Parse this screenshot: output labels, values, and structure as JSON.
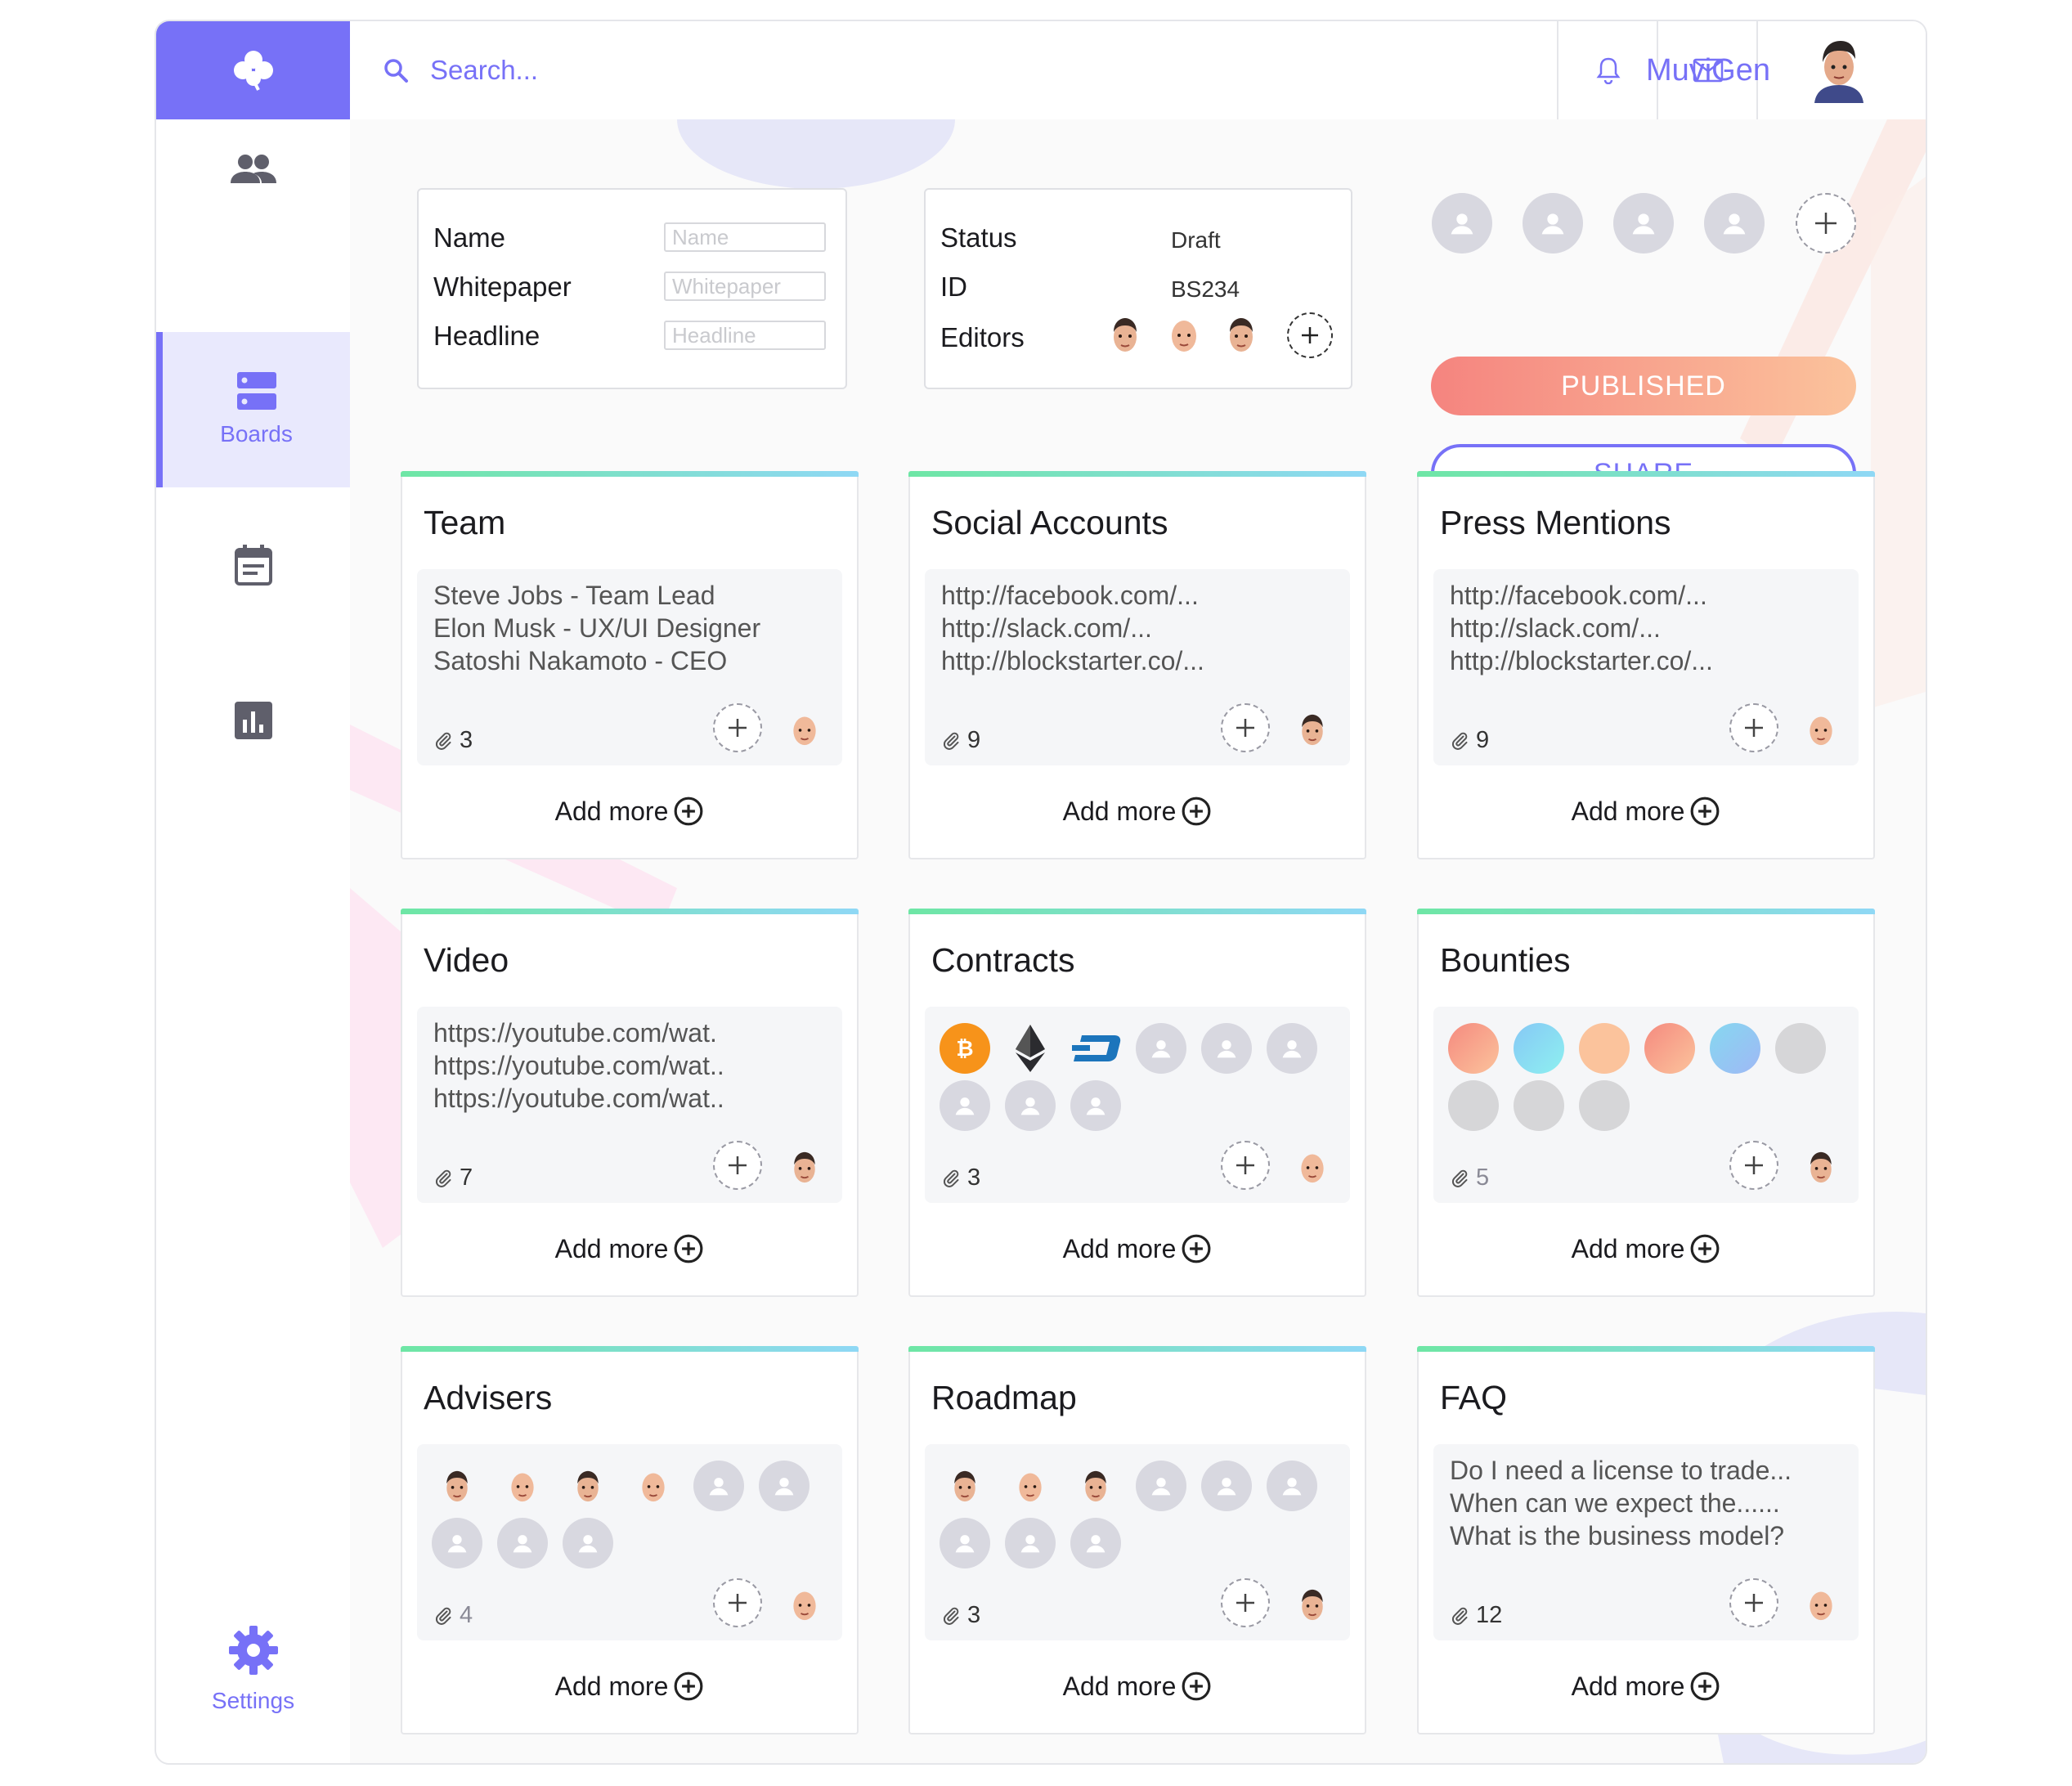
{
  "header": {
    "search_placeholder": "Search...",
    "user_name": "MuviGen"
  },
  "sidebar": {
    "items": [
      {
        "name": "people",
        "label": ""
      },
      {
        "name": "boards",
        "label": "Boards",
        "active": true
      },
      {
        "name": "calendar",
        "label": ""
      },
      {
        "name": "stats",
        "label": ""
      }
    ],
    "settings_label": "Settings"
  },
  "meta_form": {
    "name_label": "Name",
    "name_placeholder": "Name",
    "whitepaper_label": "Whitepaper",
    "whitepaper_placeholder": "Whitepaper",
    "headline_label": "Headline",
    "headline_placeholder": "Headline"
  },
  "status_box": {
    "status_label": "Status",
    "status_value": "Draft",
    "id_label": "ID",
    "id_value": "BS234",
    "editors_label": "Editors"
  },
  "actions": {
    "published_label": "PUBLISHED",
    "share_label": "SHARE"
  },
  "colors": {
    "accent": "#7771f7",
    "published_start": "#f5847f",
    "published_end": "#fbc39c",
    "card_top_start": "#6ee6a5",
    "card_top_end": "#8fd8f5"
  },
  "cards": [
    {
      "title": "Team",
      "lines": [
        "Steve Jobs - Team Lead",
        "Elon Musk - UX/UI Designer",
        "Satoshi Nakamoto - CEO"
      ],
      "attachments": "3",
      "add_more": "Add more"
    },
    {
      "title": "Social Accounts",
      "lines": [
        "http://facebook.com/...",
        "http://slack.com/...",
        "http://blockstarter.co/..."
      ],
      "attachments": "9",
      "add_more": "Add more"
    },
    {
      "title": "Press Mentions",
      "lines": [
        "http://facebook.com/...",
        "http://slack.com/...",
        "http://blockstarter.co/..."
      ],
      "attachments": "9",
      "add_more": "Add more"
    },
    {
      "title": "Video",
      "lines": [
        "https://youtube.com/wat.",
        "https://youtube.com/wat..",
        "https://youtube.com/wat.."
      ],
      "attachments": "7",
      "add_more": "Add more"
    },
    {
      "title": "Contracts",
      "icons": [
        "bitcoin-icon",
        "ethereum-icon",
        "dash-icon"
      ],
      "attachments": "3",
      "add_more": "Add more"
    },
    {
      "title": "Bounties",
      "swatches": [
        "#f58a7f",
        "#86c8f5",
        "#fbc39c",
        "#f58a7f",
        "#86d8f0"
      ],
      "attachments": "5",
      "add_more": "Add more"
    },
    {
      "title": "Advisers",
      "attachments": "4",
      "add_more": "Add more"
    },
    {
      "title": "Roadmap",
      "attachments": "3",
      "add_more": "Add more"
    },
    {
      "title": "FAQ",
      "lines": [
        "Do I need a license to trade...",
        "When can we expect the......",
        "What is the business model?"
      ],
      "attachments": "12",
      "add_more": "Add more"
    }
  ]
}
